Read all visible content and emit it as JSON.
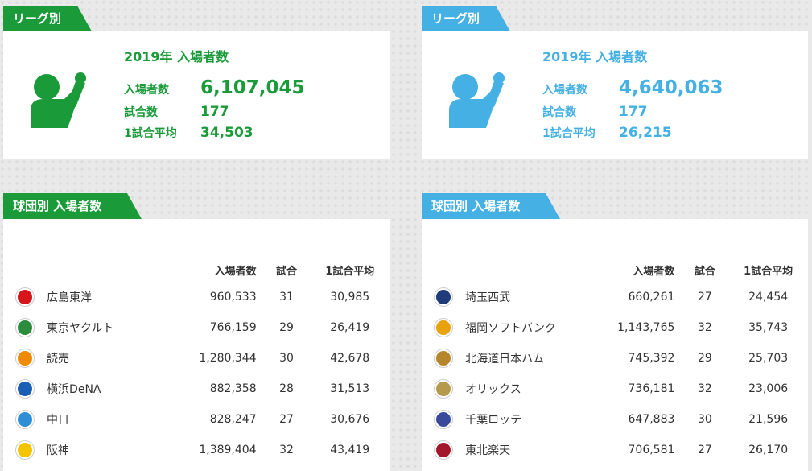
{
  "central": {
    "league_tab": "リーグ別",
    "summary": {
      "title": "2019年 入場者数",
      "attendance_label": "入場者数",
      "attendance_value": "6,107,045",
      "games_label": "試合数",
      "games_value": "177",
      "average_label": "1試合平均",
      "average_value": "34,503"
    },
    "teams_tab": "球団別 入場者数",
    "columns": [
      "入場者数",
      "試合",
      "1試合平均"
    ],
    "teams": [
      {
        "name": "広島東洋",
        "attendance": "960,533",
        "games": "31",
        "average": "30,985",
        "logo_icon": "carp-logo-icon",
        "logo_color": "#d7161c"
      },
      {
        "name": "東京ヤクルト",
        "attendance": "766,159",
        "games": "29",
        "average": "26,419",
        "logo_icon": "swallows-logo-icon",
        "logo_color": "#2a8c3c"
      },
      {
        "name": "読売",
        "attendance": "1,280,344",
        "games": "30",
        "average": "42,678",
        "logo_icon": "giants-logo-icon",
        "logo_color": "#f08a00"
      },
      {
        "name": "横浜DeNA",
        "attendance": "882,358",
        "games": "28",
        "average": "31,513",
        "logo_icon": "baystars-logo-icon",
        "logo_color": "#1a5fb4"
      },
      {
        "name": "中日",
        "attendance": "828,247",
        "games": "27",
        "average": "30,676",
        "logo_icon": "dragons-logo-icon",
        "logo_color": "#2e8fd6"
      },
      {
        "name": "阪神",
        "attendance": "1,389,404",
        "games": "32",
        "average": "43,419",
        "logo_icon": "tigers-logo-icon",
        "logo_color": "#f5c400"
      }
    ]
  },
  "pacific": {
    "league_tab": "リーグ別",
    "summary": {
      "title": "2019年 入場者数",
      "attendance_label": "入場者数",
      "attendance_value": "4,640,063",
      "games_label": "試合数",
      "games_value": "177",
      "average_label": "1試合平均",
      "average_value": "26,215"
    },
    "teams_tab": "球団別 入場者数",
    "columns": [
      "入場者数",
      "試合",
      "1試合平均"
    ],
    "teams": [
      {
        "name": "埼玉西武",
        "attendance": "660,261",
        "games": "27",
        "average": "24,454",
        "logo_icon": "lions-logo-icon",
        "logo_color": "#1f3b7a"
      },
      {
        "name": "福岡ソフトバンク",
        "attendance": "1,143,765",
        "games": "32",
        "average": "35,743",
        "logo_icon": "hawks-logo-icon",
        "logo_color": "#e8a20c"
      },
      {
        "name": "北海道日本ハム",
        "attendance": "745,392",
        "games": "29",
        "average": "25,703",
        "logo_icon": "fighters-logo-icon",
        "logo_color": "#b8862a"
      },
      {
        "name": "オリックス",
        "attendance": "736,181",
        "games": "32",
        "average": "23,006",
        "logo_icon": "buffaloes-logo-icon",
        "logo_color": "#b49a4a"
      },
      {
        "name": "千葉ロッテ",
        "attendance": "647,883",
        "games": "30",
        "average": "21,596",
        "logo_icon": "marines-logo-icon",
        "logo_color": "#3a4a9a"
      },
      {
        "name": "東北楽天",
        "attendance": "706,581",
        "games": "27",
        "average": "26,170",
        "logo_icon": "eagles-logo-icon",
        "logo_color": "#a3172c"
      }
    ]
  },
  "colors": {
    "central_accent": "#1a9a39",
    "pacific_accent": "#44b0e3"
  }
}
